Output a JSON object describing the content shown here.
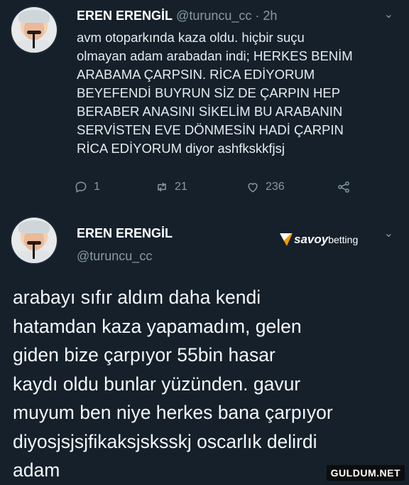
{
  "tweet1": {
    "name": "EREN ERENGİL",
    "handle": "@turuncu_cc",
    "time": "· 2h",
    "text": "avm otoparkında kaza oldu. hiçbir suçu\nolmayan adam arabadan indi; HERKES BENİM\nARABAMA ÇARPSIN. RİCA EDİYORUM\nBEYEFENDİ BUYRUN SİZ DE ÇARPIN HEP\nBERABER ANASINI SİKELİM BU ARABANIN\nSERVİSTEN EVE DÖNMESİN HADİ ÇARPIN\nRİCA EDİYORUM diyor ashfkskkfjsj",
    "actions": {
      "reply_count": "1",
      "retweet_count": "21",
      "like_count": "236"
    }
  },
  "tweet2": {
    "name": "EREN ERENGİL",
    "handle": "@turuncu_cc",
    "text": "arabayı sıfır aldım daha kendi\nhatamdan kaza yapamadım, gelen\ngiden bize çarpıyor 55bin hasar\nkaydı oldu bunlar yüzünden. gavur\nmuyum ben niye herkes bana çarpıyor\ndiyosjsjsjfikaksjsksskj oscarlık delirdi\nadam"
  },
  "brand": {
    "part1": "savoy",
    "part2": "betting"
  },
  "watermark": "GULDUM.NET",
  "icons": {
    "chevron": "chevron-down-icon",
    "reply": "reply-icon",
    "retweet": "retweet-icon",
    "like": "heart-icon",
    "share": "share-icon"
  }
}
